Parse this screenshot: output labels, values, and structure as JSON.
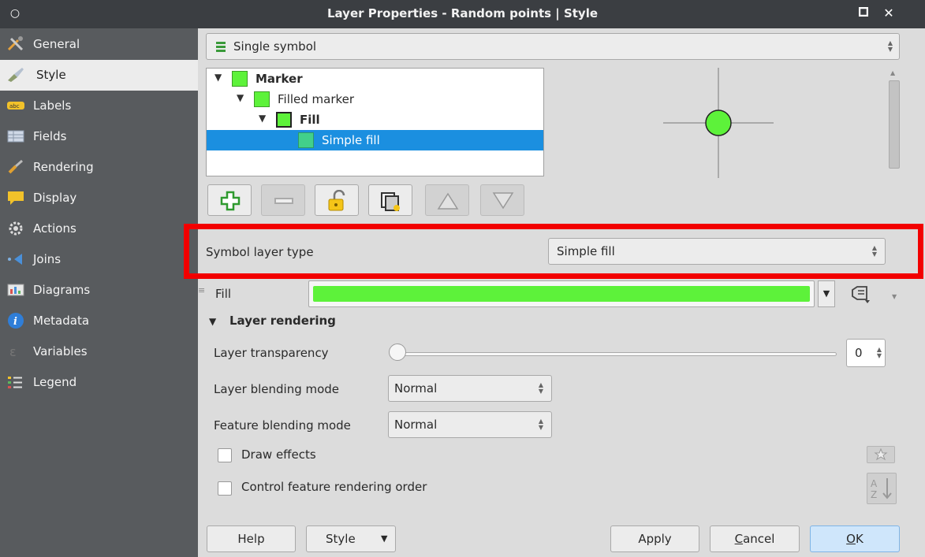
{
  "window": {
    "title": "Layer Properties - Random points | Style"
  },
  "sidebar": {
    "items": [
      {
        "label": "General",
        "icon": "tools-icon",
        "active": false
      },
      {
        "label": "Style",
        "icon": "paintbrush-icon",
        "active": true
      },
      {
        "label": "Labels",
        "icon": "abc-label-icon",
        "active": false
      },
      {
        "label": "Fields",
        "icon": "table-icon",
        "active": false
      },
      {
        "label": "Rendering",
        "icon": "brush-icon",
        "active": false
      },
      {
        "label": "Display",
        "icon": "speech-bubble-icon",
        "active": false
      },
      {
        "label": "Actions",
        "icon": "gear-icon",
        "active": false
      },
      {
        "label": "Joins",
        "icon": "join-icon",
        "active": false
      },
      {
        "label": "Diagrams",
        "icon": "diagram-icon",
        "active": false
      },
      {
        "label": "Metadata",
        "icon": "info-icon",
        "active": false
      },
      {
        "label": "Variables",
        "icon": "variables-icon",
        "active": false
      },
      {
        "label": "Legend",
        "icon": "legend-icon",
        "active": false
      }
    ]
  },
  "renderer": {
    "value": "Single symbol"
  },
  "symbol_tree": [
    {
      "label": "Marker",
      "bold": true,
      "level": 0
    },
    {
      "label": "Filled marker",
      "bold": false,
      "level": 1
    },
    {
      "label": "Fill",
      "bold": true,
      "level": 2
    },
    {
      "label": "Simple fill",
      "bold": false,
      "level": 3,
      "selected": true
    }
  ],
  "symbol_layer": {
    "label": "Symbol layer type",
    "value": "Simple fill"
  },
  "fill": {
    "label": "Fill",
    "color": "#5df23a"
  },
  "layer_rendering": {
    "title": "Layer rendering",
    "transparency_label": "Layer transparency",
    "transparency_value": "0",
    "transparency_fraction": 0,
    "layer_blending_label": "Layer blending mode",
    "layer_blending_value": "Normal",
    "feature_blending_label": "Feature blending mode",
    "feature_blending_value": "Normal",
    "draw_effects_label": "Draw effects",
    "control_order_label": "Control feature rendering order"
  },
  "buttons": {
    "help": "Help",
    "style": "Style",
    "apply": "Apply",
    "cancel_first": "C",
    "cancel_rest": "ancel",
    "ok_first": "O",
    "ok_rest": "K"
  },
  "colors": {
    "highlight": "#f20000",
    "selection": "#1b8fe0",
    "symbol_green": "#5df23a"
  }
}
